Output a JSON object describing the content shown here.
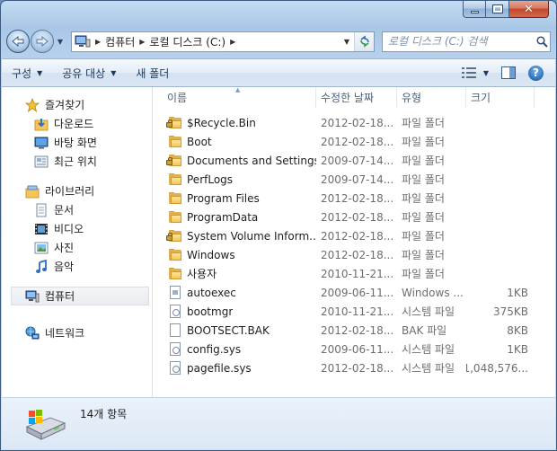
{
  "window": {
    "title": ""
  },
  "address": {
    "crumbs": [
      "컴퓨터",
      "로컬 디스크 (C:)"
    ]
  },
  "search": {
    "placeholder": "로컬 디스크 (C:) 검색"
  },
  "commands": {
    "organize": "구성",
    "share": "공유 대상",
    "new_folder": "새 폴더"
  },
  "sidebar": {
    "favorites": {
      "label": "즐겨찾기",
      "items": [
        "다운로드",
        "바탕 화면",
        "최근 위치"
      ]
    },
    "libraries": {
      "label": "라이브러리",
      "items": [
        "문서",
        "비디오",
        "사진",
        "음악"
      ]
    },
    "computer": "컴퓨터",
    "network": "네트워크"
  },
  "columns": {
    "name": "이름",
    "date": "수정한 날짜",
    "type": "유형",
    "size": "크기"
  },
  "files": [
    {
      "name": "$Recycle.Bin",
      "date": "2012-02-18...",
      "type": "파일 폴더",
      "size": "",
      "icon": "folder-locked"
    },
    {
      "name": "Boot",
      "date": "2012-02-18...",
      "type": "파일 폴더",
      "size": "",
      "icon": "folder"
    },
    {
      "name": "Documents and Settings",
      "date": "2009-07-14...",
      "type": "파일 폴더",
      "size": "",
      "icon": "folder-locked"
    },
    {
      "name": "PerfLogs",
      "date": "2009-07-14...",
      "type": "파일 폴더",
      "size": "",
      "icon": "folder"
    },
    {
      "name": "Program Files",
      "date": "2012-02-18...",
      "type": "파일 폴더",
      "size": "",
      "icon": "folder"
    },
    {
      "name": "ProgramData",
      "date": "2012-02-18...",
      "type": "파일 폴더",
      "size": "",
      "icon": "folder"
    },
    {
      "name": "System Volume Inform...",
      "date": "2012-02-18...",
      "type": "파일 폴더",
      "size": "",
      "icon": "folder-locked"
    },
    {
      "name": "Windows",
      "date": "2012-02-18...",
      "type": "파일 폴더",
      "size": "",
      "icon": "folder"
    },
    {
      "name": "사용자",
      "date": "2010-11-21...",
      "type": "파일 폴더",
      "size": "",
      "icon": "folder"
    },
    {
      "name": "autoexec",
      "date": "2009-06-11...",
      "type": "Windows ...",
      "size": "1KB",
      "icon": "file-batch"
    },
    {
      "name": "bootmgr",
      "date": "2010-11-21...",
      "type": "시스템 파일",
      "size": "375KB",
      "icon": "file-system"
    },
    {
      "name": "BOOTSECT.BAK",
      "date": "2012-02-18...",
      "type": "BAK 파일",
      "size": "8KB",
      "icon": "file"
    },
    {
      "name": "config.sys",
      "date": "2009-06-11...",
      "type": "시스템 파일",
      "size": "1KB",
      "icon": "file-system"
    },
    {
      "name": "pagefile.sys",
      "date": "2012-02-18...",
      "type": "시스템 파일",
      "size": "1,048,576...",
      "icon": "file-system"
    }
  ],
  "status": {
    "item_count": "14개 항목"
  }
}
